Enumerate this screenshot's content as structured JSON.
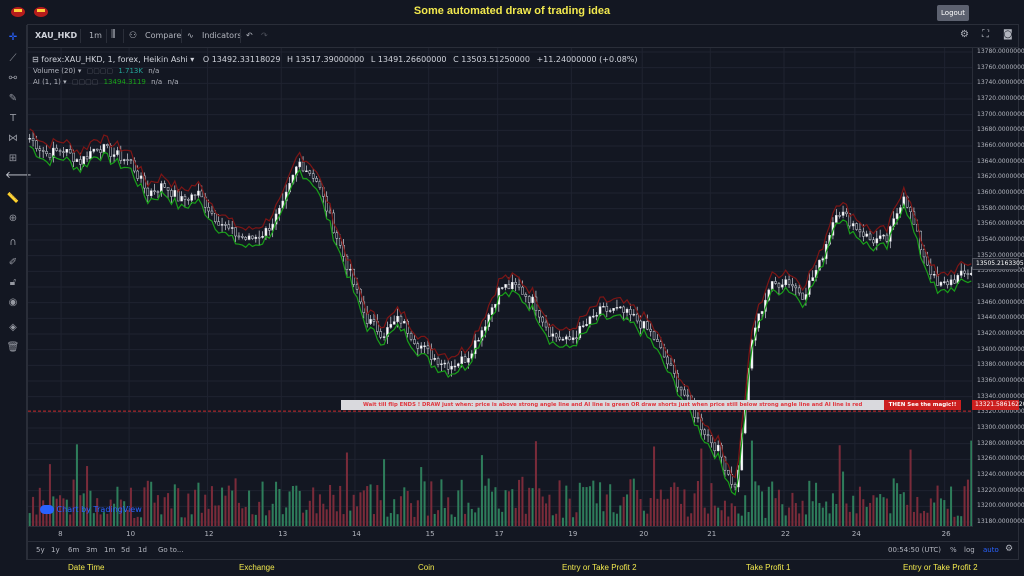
{
  "app": {
    "title": "Some automated draw of trading idea",
    "logout_label": "Logout"
  },
  "toolbar": {
    "symbol": "XAU_HKD",
    "interval": "1m",
    "compare_label": "Compare",
    "indicators_label": "Indicators",
    "icons": [
      "candle-style-icon",
      "compare-icon",
      "indicators-icon",
      "undo-icon",
      "redo-icon",
      "settings-icon",
      "fullscreen-icon",
      "camera-icon"
    ]
  },
  "legend": {
    "symbol_line": "forex:XAU_HKD, 1, forex, Heikin Ashi",
    "open": "O 13492.33118029",
    "high": "H 13517.39000000",
    "low": "L 13491.26600000",
    "close": "C 13503.51250000",
    "change": "+11.24000000 (+0.08%)",
    "volume_label": "Volume (20)",
    "volume_value": "1.713K",
    "volume_na": "n/a",
    "ai_label": "AI (1, 1)",
    "ai_value": "13494.3119",
    "ai_na1": "n/a",
    "ai_na2": "n/a"
  },
  "price_axis": {
    "ticks": [
      "13780.00000000",
      "13760.00000000",
      "13740.00000000",
      "13720.00000000",
      "13700.00000000",
      "13680.00000000",
      "13660.00000000",
      "13640.00000000",
      "13620.00000000",
      "13600.00000000",
      "13580.00000000",
      "13560.00000000",
      "13540.00000000",
      "13520.00000000",
      "13500.00000000",
      "13480.00000000",
      "13460.00000000",
      "13440.00000000",
      "13420.00000000",
      "13400.00000000",
      "13380.00000000",
      "13360.00000000",
      "13340.00000000",
      "13320.00000000",
      "13300.00000000",
      "13280.00000000",
      "13260.00000000",
      "13240.00000000",
      "13220.00000000",
      "13200.00000000",
      "13180.00000000"
    ],
    "current_price_tag": "13505.21633050",
    "line_price_tag": "13321.58616220"
  },
  "time_axis": {
    "ticks": [
      "8",
      "10",
      "12",
      "13",
      "14",
      "15",
      "17",
      "19",
      "20",
      "21",
      "22",
      "24",
      "26"
    ]
  },
  "range_bar": {
    "buttons": [
      "5y",
      "1y",
      "6m",
      "3m",
      "1m",
      "5d",
      "1d"
    ],
    "goto_label": "Go to...",
    "clock": "00:54:50 (UTC)",
    "percent": "%",
    "log": "log",
    "auto": "auto"
  },
  "banner": {
    "text": "Wait till flip ENDS  !   DRAW just when:  price is above strong angle line and AI line is green        OR        draw shorts just when price still below strong angle line and AI line is red",
    "cta": "THEN See the magic!!"
  },
  "watermark": "Chart by TradingView",
  "footer": {
    "columns": [
      "Date Time",
      "Exchange",
      "Coin",
      "Entry or Take Profit 2",
      "Take Profit 1",
      "Entry or Take Profit 2"
    ]
  },
  "left_tools": [
    "crosshair-icon",
    "trendline-icon",
    "fib-icon",
    "brush-icon",
    "text-icon",
    "pattern-icon",
    "forecast-icon",
    "back-arrow-icon",
    "ruler-icon",
    "zoom-icon",
    "magnet-icon",
    "lock-drawings-icon",
    "lock-icon",
    "eye-icon",
    "layers-icon",
    "trash-icon"
  ],
  "colors": {
    "background": "#131722",
    "title": "#f2e94e",
    "up": "#ffffff",
    "down": "#2a2e39",
    "ai_green": "#19a019",
    "angle_red": "#8b1a1a",
    "vol_up": "#2e7d5b",
    "vol_down": "#7a2b3a"
  },
  "chart_data": {
    "type": "candlestick",
    "chart_style": "Heikin Ashi",
    "y_range": [
      13180,
      13780
    ],
    "x_ticks": [
      "8",
      "10",
      "12",
      "13",
      "14",
      "15",
      "17",
      "19",
      "20",
      "21",
      "22",
      "24",
      "26"
    ],
    "close_path": [
      13670,
      13650,
      13655,
      13640,
      13660,
      13650,
      13640,
      13600,
      13610,
      13590,
      13600,
      13570,
      13550,
      13540,
      13550,
      13580,
      13640,
      13620,
      13560,
      13500,
      13440,
      13420,
      13440,
      13410,
      13390,
      13380,
      13390,
      13430,
      13480,
      13480,
      13460,
      13420,
      13410,
      13430,
      13450,
      13450,
      13440,
      13420,
      13380,
      13340,
      13300,
      13270,
      13220,
      13420,
      13480,
      13490,
      13470,
      13510,
      13580,
      13560,
      13540,
      13540,
      13600,
      13530,
      13480,
      13490,
      13500
    ]
  }
}
